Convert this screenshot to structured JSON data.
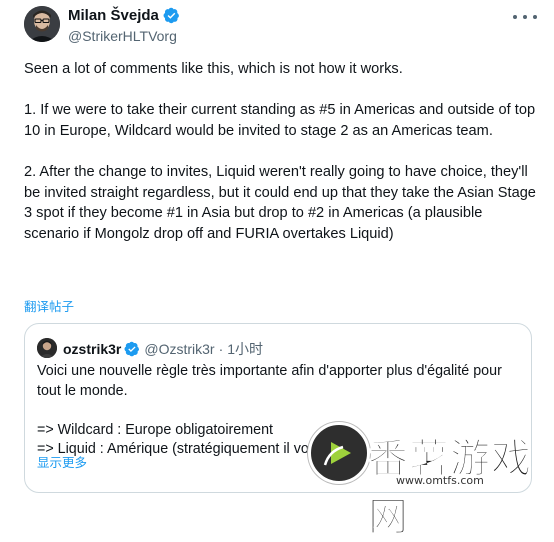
{
  "author": {
    "name": "Milan Švejda",
    "handle": "@StrikerHLTVorg",
    "verified": true,
    "avatar": "person-photo"
  },
  "more_icon": "ellipsis-icon",
  "body": {
    "para1": "Seen a lot of comments like this, which is not how it works.",
    "para2": "1. If we were to take their current standing as #5 in Americas and outside of top 10 in Europe, Wildcard would be invited to stage 2 as an Americas team.",
    "para3": "2. After the change to invites, Liquid weren't really going to have choice, they'll be invited straight regardless, but it could end up that they take the Asian Stage 3 spot if they become #1 in Asia but drop to #2 in Americas (a plausible scenario if Mongolz drop off and FURIA overtakes Liquid)"
  },
  "translate_label": "翻译帖子",
  "quote": {
    "name": "ozstrik3r",
    "handle": "@Ozstrik3r",
    "separator": "·",
    "time": "1小时",
    "verified": true,
    "line1": "Voici une nouvelle règle très importante afin d'apporter plus d'égalité pour tout le monde.",
    "line2": "=> Wildcard : Europe obligatoirement",
    "line3": "=> Liquid : Amérique (stratégiquement il vou",
    "show_more": "显示更多"
  },
  "watermark": {
    "text": "番薯游戏网",
    "url": "www.omtfs.com"
  },
  "colors": {
    "link_blue": "#1d9bf0",
    "verified_blue": "#1d9bf0",
    "secondary_text": "#536471",
    "border": "#cfd9de"
  }
}
